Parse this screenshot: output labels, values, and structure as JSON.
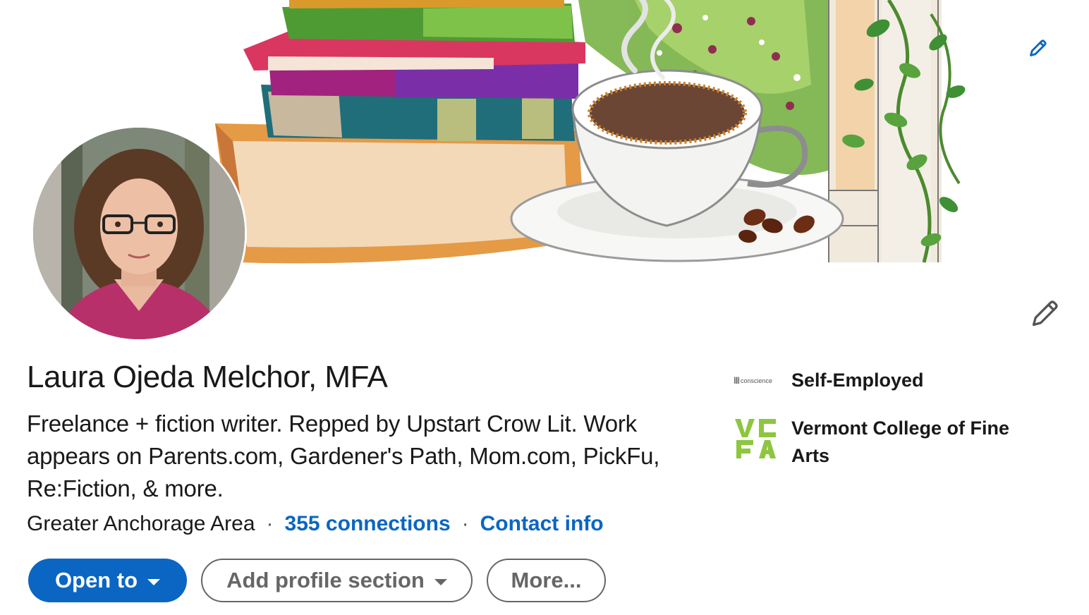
{
  "profile": {
    "name": "Laura Ojeda Melchor, MFA",
    "headline": "Freelance + fiction writer. Repped by Upstart Crow Lit. Work appears on Parents.com, Gardener's Path, Mom.com, PickFu, Re:Fiction, & more.",
    "location": "Greater Anchorage Area",
    "connections": "355 connections",
    "contact_info": "Contact info",
    "separator": "·"
  },
  "experience": [
    {
      "label": "Self-Employed",
      "logo_text": "conscience",
      "logo": "conscience-logo"
    },
    {
      "label": "Vermont College of Fine Arts",
      "logo": "vcfa-logo",
      "logo_text": "VCFA"
    }
  ],
  "actions": {
    "open_to": "Open to",
    "add_section": "Add profile section",
    "more": "More..."
  },
  "icons": {
    "banner_edit": "pencil-icon",
    "intro_edit": "pencil-icon",
    "dropdown": "caret-down-icon"
  },
  "colors": {
    "accent": "#0a66c2",
    "secondary": "#666666",
    "text": "#191919",
    "vcfa_green": "#8dc63f"
  }
}
